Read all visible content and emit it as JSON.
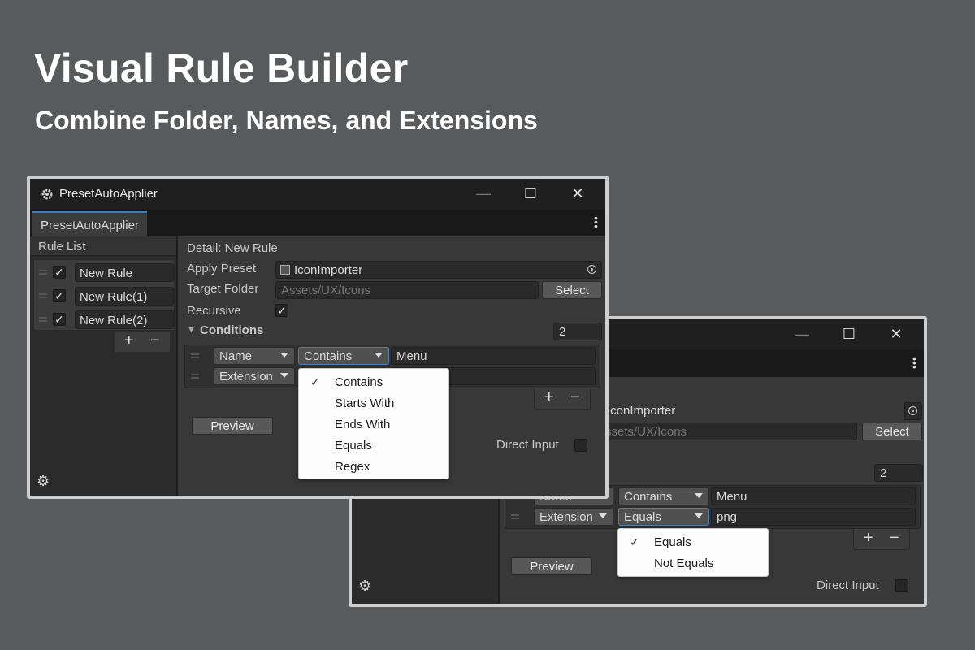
{
  "hero": {
    "title": "Visual Rule Builder",
    "subtitle": "Combine Folder, Names, and Extensions"
  },
  "window": {
    "title": "PresetAutoApplier",
    "tab": "PresetAutoApplier",
    "minimize_glyph": "—",
    "maximize_glyph": "☐",
    "close_glyph": "✕"
  },
  "rule_list": {
    "header": "Rule List",
    "items": [
      {
        "label": "New Rule",
        "checked": true
      },
      {
        "label": "New Rule(1)",
        "checked": true
      },
      {
        "label": "New Rule(2)",
        "checked": true
      }
    ],
    "add_label": "+",
    "remove_label": "−"
  },
  "detail": {
    "header": "Detail: New Rule",
    "apply_preset_label": "Apply Preset",
    "apply_preset_value": "IconImporter",
    "target_folder_label": "Target Folder",
    "target_folder_value": "Assets/UX/Icons",
    "select_label": "Select",
    "recursive_label": "Recursive",
    "conditions_label": "Conditions",
    "conditions_count": "2",
    "conditions": [
      {
        "field": "Name",
        "operator": "Contains",
        "value": "Menu"
      },
      {
        "field": "Extension",
        "operator": "Equals",
        "value": "png"
      }
    ],
    "add_label": "+",
    "remove_label": "−",
    "preview_label": "Preview",
    "direct_input_label": "Direct Input"
  },
  "popup_front": {
    "options": [
      "Contains",
      "Starts With",
      "Ends With",
      "Equals",
      "Regex"
    ],
    "selected": "Contains",
    "check_glyph": "✓"
  },
  "popup_back": {
    "options": [
      "Equals",
      "Not Equals"
    ],
    "selected": "Equals",
    "check_glyph": "✓"
  },
  "colors": {
    "background": "#595a5c",
    "window_body": "#383838",
    "tab_accent": "#3a79bb",
    "popup_bg": "#fdfdfd"
  }
}
